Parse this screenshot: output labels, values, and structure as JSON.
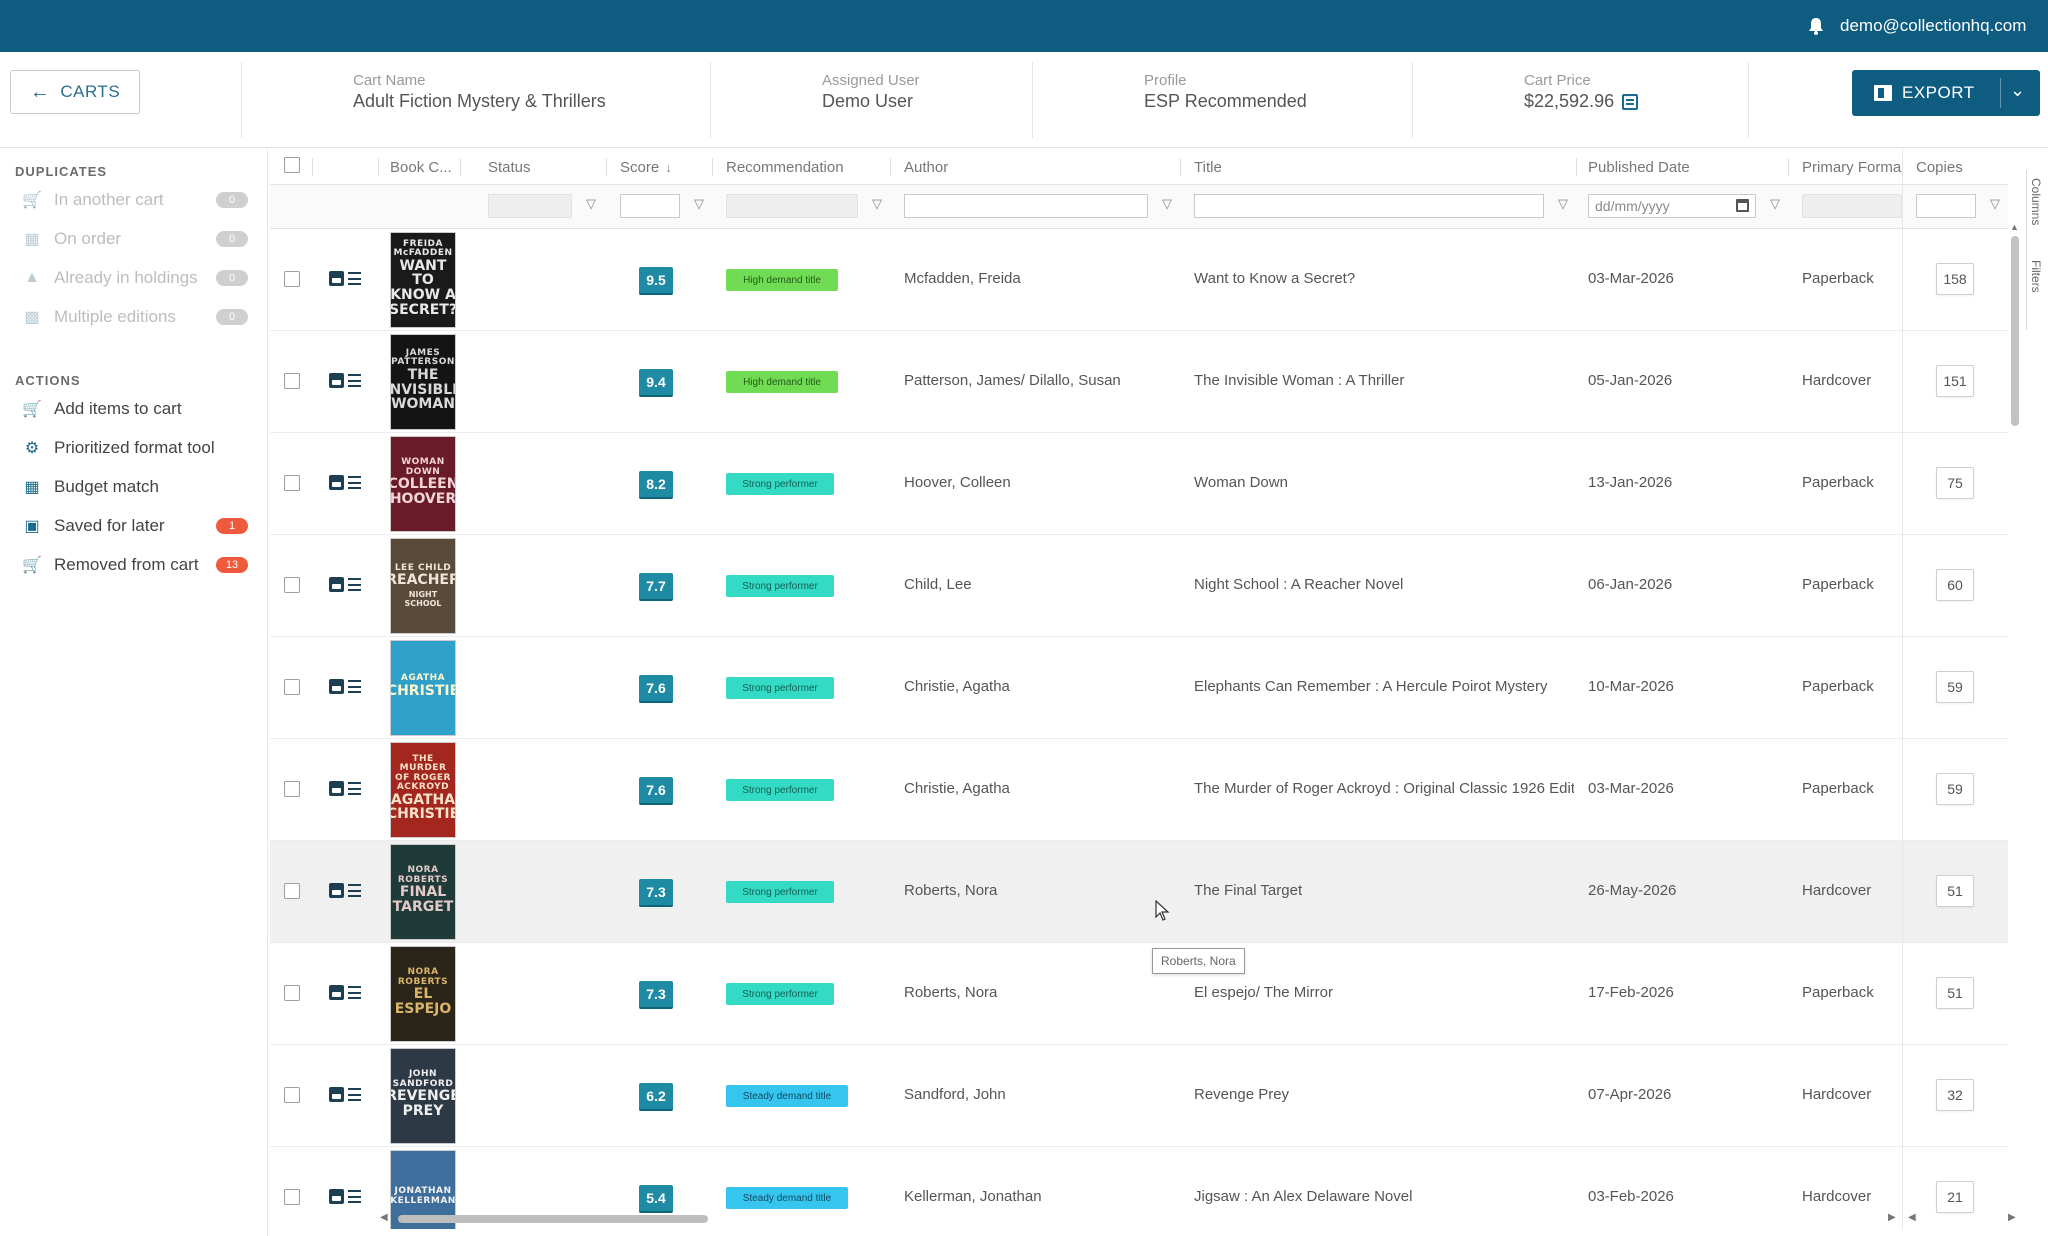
{
  "topbar": {
    "user_email": "demo@collectionhq.com",
    "bg_color": "#0e5c80"
  },
  "header": {
    "back_label": "CARTS",
    "fields": [
      {
        "label": "Cart Name",
        "value": "Adult Fiction Mystery & Thrillers"
      },
      {
        "label": "Assigned User",
        "value": "Demo User"
      },
      {
        "label": "Profile",
        "value": "ESP Recommended"
      },
      {
        "label": "Cart Price",
        "value": "$22,592.96"
      }
    ],
    "export_label": "EXPORT"
  },
  "sidebar": {
    "duplicates_title": "DUPLICATES",
    "duplicates": [
      {
        "label": "In another cart",
        "count": "0",
        "icon": "cart-icon"
      },
      {
        "label": "On order",
        "count": "0",
        "icon": "order-icon"
      },
      {
        "label": "Already in holdings",
        "count": "0",
        "icon": "library-icon"
      },
      {
        "label": "Multiple editions",
        "count": "0",
        "icon": "editions-icon"
      }
    ],
    "actions_title": "ACTIONS",
    "actions": [
      {
        "label": "Add items to cart",
        "count": "",
        "icon": "add-cart-icon"
      },
      {
        "label": "Prioritized format tool",
        "count": "",
        "icon": "format-tool-icon"
      },
      {
        "label": "Budget match",
        "count": "",
        "icon": "budget-icon"
      },
      {
        "label": "Saved for later",
        "count": "1",
        "icon": "saved-icon"
      },
      {
        "label": "Removed from cart",
        "count": "13",
        "icon": "removed-cart-icon"
      }
    ]
  },
  "grid": {
    "columns": {
      "book_cover": "Book C...",
      "status": "Status",
      "score": "Score",
      "recommendation": "Recommendation",
      "author": "Author",
      "title": "Title",
      "published_date": "Published Date",
      "primary_format": "Primary Forma",
      "copies": "Copies"
    },
    "date_placeholder": "dd/mm/yyyy",
    "rows": [
      {
        "score": "9.5",
        "recommendation": "High demand title",
        "rec_type": "high",
        "author": "Mcfadden, Freida",
        "title": "Want to Know a Secret?",
        "published": "03-Mar-2026",
        "format": "Paperback",
        "copies": "158",
        "cover": {
          "t1": "FREIDA McFADDEN",
          "t2": "WANT TO KNOW A SECRET?",
          "t3": "",
          "bg": "#1a1a1a",
          "fg": "#e8e8e8"
        }
      },
      {
        "score": "9.4",
        "recommendation": "High demand title",
        "rec_type": "high",
        "author": "Patterson, James/ Dilallo, Susan",
        "title": "The Invisible Woman : A Thriller",
        "published": "05-Jan-2026",
        "format": "Hardcover",
        "copies": "151",
        "cover": {
          "t1": "JAMES PATTERSON",
          "t2": "THE INVISIBLE WOMAN",
          "t3": "",
          "bg": "#141414",
          "fg": "#d9d9d9"
        }
      },
      {
        "score": "8.2",
        "recommendation": "Strong performer",
        "rec_type": "strong",
        "author": "Hoover, Colleen",
        "title": "Woman Down",
        "published": "13-Jan-2026",
        "format": "Paperback",
        "copies": "75",
        "cover": {
          "t1": "WOMAN DOWN",
          "t2": "COLLEEN HOOVER",
          "t3": "",
          "bg": "#6a1b2a",
          "fg": "#f2d6d6"
        }
      },
      {
        "score": "7.7",
        "recommendation": "Strong performer",
        "rec_type": "strong",
        "author": "Child, Lee",
        "title": "Night School : A Reacher Novel",
        "published": "06-Jan-2026",
        "format": "Paperback",
        "copies": "60",
        "cover": {
          "t1": "LEE CHILD",
          "t2": "REACHER",
          "t3": "NIGHT SCHOOL",
          "bg": "#5a4a3a",
          "fg": "#f0e6d8"
        }
      },
      {
        "score": "7.6",
        "recommendation": "Strong performer",
        "rec_type": "strong",
        "author": "Christie, Agatha",
        "title": "Elephants Can Remember : A Hercule Poirot Mystery",
        "published": "10-Mar-2026",
        "format": "Paperback",
        "copies": "59",
        "cover": {
          "t1": "AGATHA",
          "t2": "CHRISTIE",
          "t3": "",
          "bg": "#2fa0c9",
          "fg": "#fff7d0"
        }
      },
      {
        "score": "7.6",
        "recommendation": "Strong performer",
        "rec_type": "strong",
        "author": "Christie, Agatha",
        "title": "The Murder of Roger Ackroyd : Original Classic 1926 Editic",
        "published": "03-Mar-2026",
        "format": "Paperback",
        "copies": "59",
        "cover": {
          "t1": "THE MURDER OF ROGER ACKROYD",
          "t2": "AGATHA CHRISTIE",
          "t3": "",
          "bg": "#a3261f",
          "fg": "#f6e2c9"
        }
      },
      {
        "score": "7.3",
        "recommendation": "Strong performer",
        "rec_type": "strong",
        "author": "Roberts, Nora",
        "title": "The Final Target",
        "published": "26-May-2026",
        "format": "Hardcover",
        "copies": "51",
        "cover": {
          "t1": "NORA ROBERTS",
          "t2": "FINAL TARGET",
          "t3": "",
          "bg": "#1e3b3a",
          "fg": "#e6c9c9"
        }
      },
      {
        "score": "7.3",
        "recommendation": "Strong performer",
        "rec_type": "strong",
        "author": "Roberts, Nora",
        "title": "El espejo/ The Mirror",
        "published": "17-Feb-2026",
        "format": "Paperback",
        "copies": "51",
        "cover": {
          "t1": "NORA ROBERTS",
          "t2": "EL ESPEJO",
          "t3": "",
          "bg": "#2b2418",
          "fg": "#d9b56a"
        }
      },
      {
        "score": "6.2",
        "recommendation": "Steady demand title",
        "rec_type": "steady",
        "author": "Sandford, John",
        "title": "Revenge Prey",
        "published": "07-Apr-2026",
        "format": "Hardcover",
        "copies": "32",
        "cover": {
          "t1": "JOHN SANDFORD",
          "t2": "REVENGE PREY",
          "t3": "",
          "bg": "#2d3a45",
          "fg": "#f0f0f0"
        }
      },
      {
        "score": "5.4",
        "recommendation": "Steady demand title",
        "rec_type": "steady",
        "author": "Kellerman, Jonathan",
        "title": "Jigsaw : An Alex Delaware Novel",
        "published": "03-Feb-2026",
        "format": "Hardcover",
        "copies": "21",
        "cover": {
          "t1": "JONATHAN KELLERMAN",
          "t2": "",
          "t3": "",
          "bg": "#3e6f9c",
          "fg": "#f2f2f2"
        }
      }
    ]
  },
  "side_panel": {
    "columns_tab": "Columns",
    "filters_tab": "Filters"
  },
  "tooltip": "Roberts, Nora"
}
